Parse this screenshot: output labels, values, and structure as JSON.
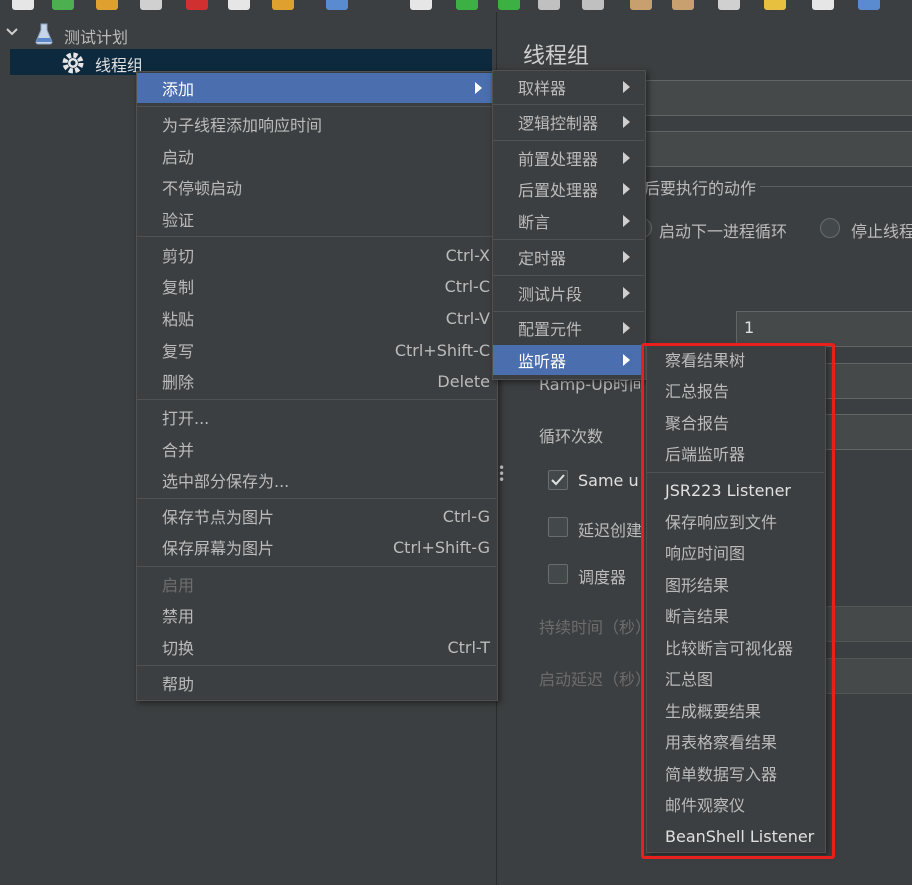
{
  "tree": {
    "items": [
      {
        "label": "测试计划",
        "icon": "flask-icon"
      },
      {
        "label": "线程组",
        "icon": "gear-icon"
      }
    ]
  },
  "right_panel": {
    "title": "线程组",
    "action_group_label": "后要执行的动作",
    "radio_next_loop": "启动下一进程循环",
    "radio_stop_thread": "停止线程",
    "threads_value": "1",
    "rampup_label": "Ramp-Up时间",
    "loop_label": "循环次数",
    "same_user_label": "Same u",
    "delay_label": "延迟创建",
    "scheduler_label": "调度器",
    "duration_label": "持续时间（秒）",
    "startup_delay_label": "启动延迟（秒）"
  },
  "context_menu": {
    "items": [
      {
        "label": "添加",
        "shortcut": "",
        "submenu": true,
        "highlighted": true
      },
      {
        "label": "为子线程添加响应时间",
        "shortcut": ""
      },
      {
        "label": "启动",
        "shortcut": ""
      },
      {
        "label": "不停顿启动",
        "shortcut": ""
      },
      {
        "label": "验证",
        "shortcut": ""
      },
      {
        "label": "剪切",
        "shortcut": "Ctrl-X"
      },
      {
        "label": "复制",
        "shortcut": "Ctrl-C"
      },
      {
        "label": "粘贴",
        "shortcut": "Ctrl-V"
      },
      {
        "label": "复写",
        "shortcut": "Ctrl+Shift-C"
      },
      {
        "label": "删除",
        "shortcut": "Delete"
      },
      {
        "label": "打开...",
        "shortcut": ""
      },
      {
        "label": "合并",
        "shortcut": ""
      },
      {
        "label": "选中部分保存为...",
        "shortcut": ""
      },
      {
        "label": "保存节点为图片",
        "shortcut": "Ctrl-G"
      },
      {
        "label": "保存屏幕为图片",
        "shortcut": "Ctrl+Shift-G"
      },
      {
        "label": "启用",
        "shortcut": "",
        "disabled": true
      },
      {
        "label": "禁用",
        "shortcut": ""
      },
      {
        "label": "切换",
        "shortcut": "Ctrl-T"
      },
      {
        "label": "帮助",
        "shortcut": ""
      }
    ]
  },
  "add_submenu": {
    "items": [
      {
        "label": "取样器",
        "submenu": true
      },
      {
        "label": "逻辑控制器",
        "submenu": true
      },
      {
        "label": "前置处理器",
        "submenu": true
      },
      {
        "label": "后置处理器",
        "submenu": true
      },
      {
        "label": "断言",
        "submenu": true
      },
      {
        "label": "定时器",
        "submenu": true
      },
      {
        "label": "测试片段",
        "submenu": true
      },
      {
        "label": "配置元件",
        "submenu": true
      },
      {
        "label": "监听器",
        "submenu": true,
        "highlighted": true
      }
    ]
  },
  "listener_submenu": {
    "items": [
      {
        "label": "察看结果树"
      },
      {
        "label": "汇总报告"
      },
      {
        "label": "聚合报告"
      },
      {
        "label": "后端监听器"
      },
      {
        "label": "JSR223 Listener"
      },
      {
        "label": "保存响应到文件"
      },
      {
        "label": "响应时间图"
      },
      {
        "label": "图形结果"
      },
      {
        "label": "断言结果"
      },
      {
        "label": "比较断言可视化器"
      },
      {
        "label": "汇总图"
      },
      {
        "label": "生成概要结果"
      },
      {
        "label": "用表格察看结果"
      },
      {
        "label": "简单数据写入器"
      },
      {
        "label": "邮件观察仪"
      },
      {
        "label": "BeanShell Listener"
      }
    ]
  },
  "colors": {
    "background": "#3c3f41",
    "menu_highlight": "#4b6eaf",
    "annotation_box": "#e8201d",
    "tree_selected": "#0d293e"
  }
}
